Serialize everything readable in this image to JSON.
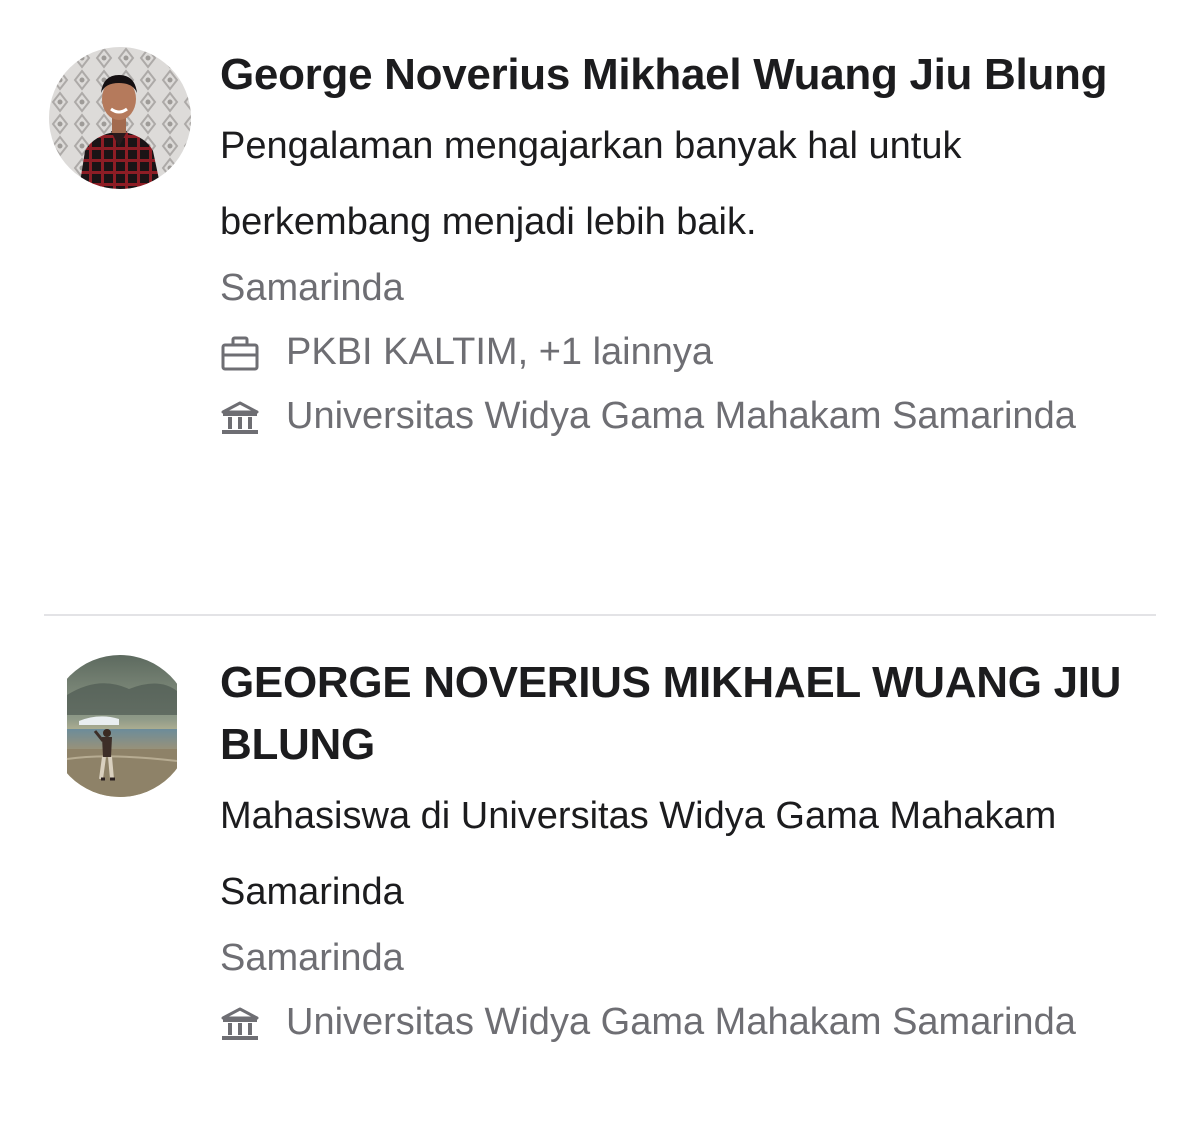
{
  "results": [
    {
      "name": "George Noverius Mikhael Wuang Jiu Blung",
      "headline": "Pengalaman mengajarkan banyak hal untuk berkembang menjadi lebih baik.",
      "location": "Samarinda",
      "work": "PKBI KALTIM, +1 lainnya",
      "education": "Universitas Widya Gama Mahakam Samarinda",
      "work_icon": "briefcase-icon",
      "education_icon": "school-icon"
    },
    {
      "name": "GEORGE NOVERIUS MIKHAEL WUANG JIU BLUNG",
      "headline": "Mahasiswa di Universitas Widya Gama Mahakam Samarinda",
      "location": "Samarinda",
      "education": "Universitas Widya Gama Mahakam Samarinda",
      "education_icon": "school-icon"
    }
  ],
  "colors": {
    "primary_text": "#1c1c1e",
    "secondary_text": "#6e6e73",
    "divider": "#e3e3e6"
  }
}
